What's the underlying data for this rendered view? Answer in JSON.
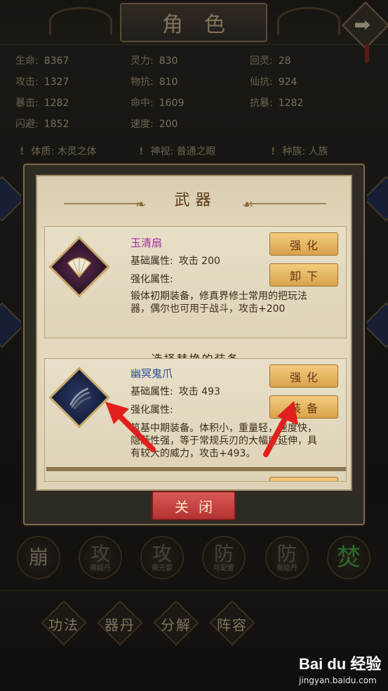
{
  "screen": {
    "title": "角色",
    "next_icon": "arrow-right-icon",
    "stats": [
      {
        "k": "生命:",
        "v": "8367"
      },
      {
        "k": "灵力:",
        "v": "830"
      },
      {
        "k": "回灵:",
        "v": "28"
      },
      {
        "k": "攻击:",
        "v": "1327"
      },
      {
        "k": "物抗:",
        "v": "810"
      },
      {
        "k": "仙抗:",
        "v": "924"
      },
      {
        "k": "暴击:",
        "v": "1282"
      },
      {
        "k": "命中:",
        "v": "1609"
      },
      {
        "k": "抗暴:",
        "v": "1282"
      },
      {
        "k": "闪避:",
        "v": "1852"
      },
      {
        "k": "速度:",
        "v": "200"
      }
    ],
    "traits": [
      {
        "label": "体质:",
        "value": "木灵之体"
      },
      {
        "label": "神视:",
        "value": "普通之眼"
      },
      {
        "label": "种族:",
        "value": "人族"
      }
    ],
    "skills": [
      {
        "big": "崩",
        "small": ""
      },
      {
        "big": "攻",
        "small": "需结丹"
      },
      {
        "big": "攻",
        "small": "需元婴"
      },
      {
        "big": "防",
        "small": "可配置"
      },
      {
        "big": "防",
        "small": "需结丹"
      },
      {
        "big": "焚",
        "small": ""
      }
    ],
    "menu": [
      "功法",
      "器丹",
      "分解",
      "阵容"
    ]
  },
  "dialog": {
    "title": "武器",
    "current": {
      "name": "玉清扇",
      "base_label": "基础属性:",
      "base_value": "攻击 200",
      "enh_label": "强化属性:",
      "desc": "锻体初期装备，修真界修士常用的把玩法器，偶尔也可用于战斗，攻击+200",
      "btn1": "强化",
      "btn2": "卸下",
      "icon": "fan-icon"
    },
    "section": "选择替换的装备",
    "candidate": {
      "name": "幽冥鬼爪",
      "base_label": "基础属性:",
      "base_value": "攻击 493",
      "enh_label": "强化属性:",
      "desc": "筑基中期装备。体积小，重量轻，速度快，隐蔽性强，等于常规兵刃的大幅度延伸，具有较大的威力，攻击+493。",
      "btn1": "强化",
      "btn2": "装备",
      "icon": "claw-icon"
    },
    "close": "关闭"
  },
  "watermark": {
    "logo": "Bai du 经验",
    "sub": "jingyan.baidu.com"
  },
  "colors": {
    "gold_button": "#e6b865",
    "close_button": "#c84443",
    "arrow": "#e0201e",
    "purple_name": "#a52ea0",
    "blue_name": "#2c4e9a",
    "green_skill": "#44a544"
  }
}
